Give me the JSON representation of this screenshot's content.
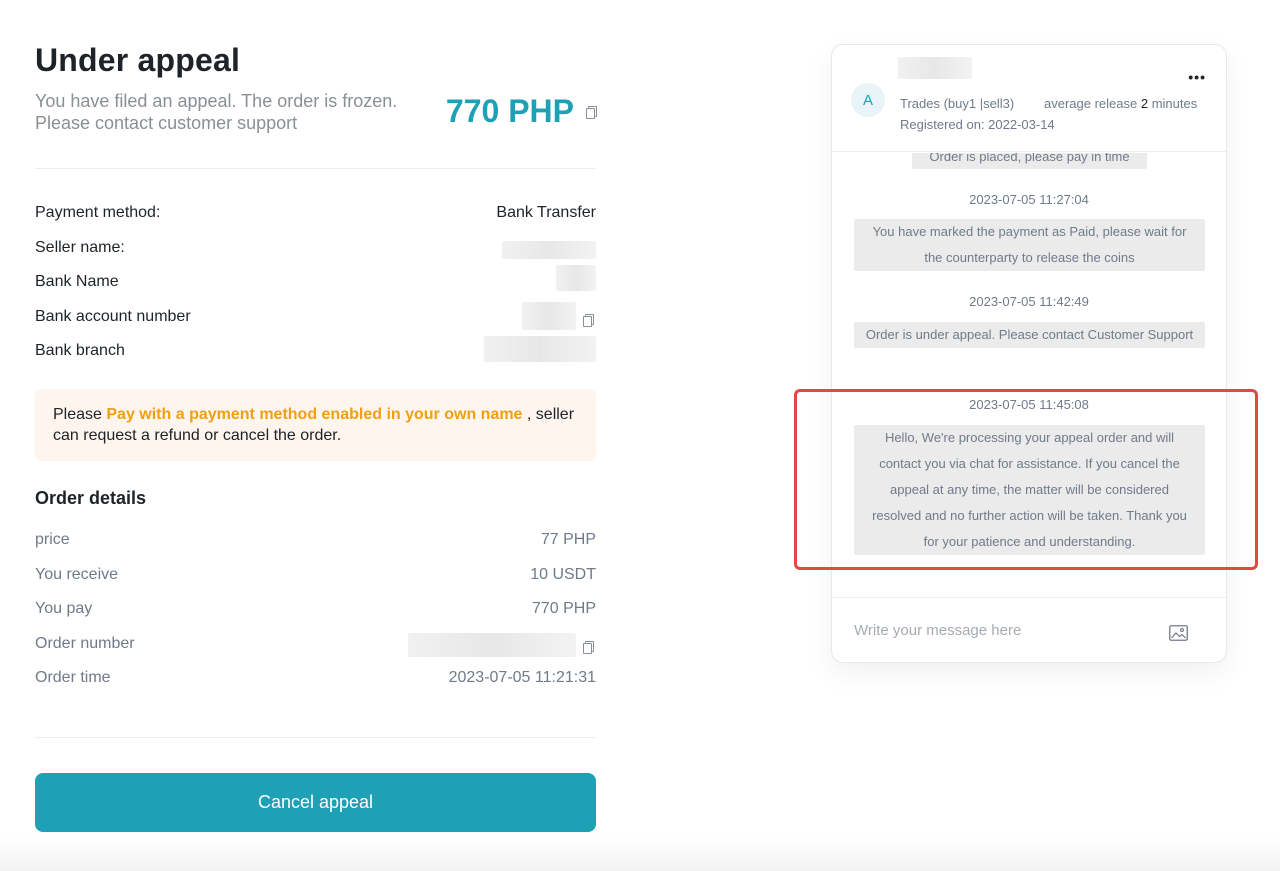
{
  "header": {
    "title": "Under appeal",
    "subtitle": "You have filed an appeal. The order is frozen. Please contact customer support",
    "amount": "770 PHP"
  },
  "payment": {
    "method_label": "Payment method:",
    "method_value": "Bank Transfer",
    "seller_name_label": "Seller name:",
    "bank_name_label": "Bank Name",
    "bank_account_label": "Bank account number",
    "bank_branch_label": "Bank branch"
  },
  "notice": {
    "prefix": "Please ",
    "highlight": "Pay with a payment method enabled in your own name",
    "suffix": " , seller can request a refund or cancel the order."
  },
  "order_details": {
    "title": "Order details",
    "rows": [
      {
        "label": "price",
        "value": "77 PHP"
      },
      {
        "label": "You receive",
        "value": "10 USDT"
      },
      {
        "label": "You pay",
        "value": "770 PHP"
      },
      {
        "label": "Order number",
        "value": ""
      },
      {
        "label": "Order time",
        "value": "2023-07-05 11:21:31"
      }
    ]
  },
  "actions": {
    "cancel_appeal": "Cancel appeal"
  },
  "chat": {
    "avatar_initial": "A",
    "trades": "Trades (buy1 |sell3)",
    "avg_release_prefix": "average release ",
    "avg_release_value": "2",
    "avg_release_suffix": " minutes",
    "registered": "Registered on: 2022-03-14",
    "messages": [
      {
        "time": "",
        "text": "Order is placed, please pay in time"
      },
      {
        "time": "2023-07-05 11:27:04",
        "text": "You have marked the payment as Paid, please wait for the counterparty to release the coins"
      },
      {
        "time": "2023-07-05 11:42:49",
        "text": "Order is under appeal. Please contact Customer Support"
      },
      {
        "time": "2023-07-05 11:45:08",
        "text": "Hello, We're processing your appeal order and will contact you via chat for assistance. If you cancel the appeal at any time, the matter will be considered resolved and no further action will be taken. Thank you for your patience and understanding."
      }
    ],
    "input_placeholder": "Write your message here"
  },
  "colors": {
    "accent": "#1ea1b5",
    "notice_highlight": "#f0a010",
    "annotation_box": "#e84545"
  },
  "icons": {
    "copy": "copy-icon",
    "more": "more-icon",
    "image": "image-icon"
  }
}
